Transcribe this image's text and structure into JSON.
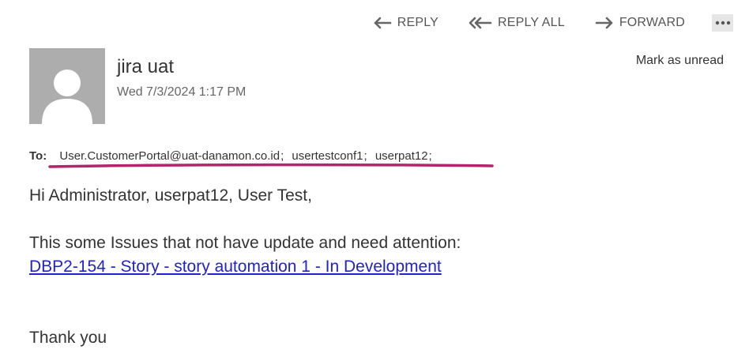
{
  "toolbar": {
    "reply": "REPLY",
    "reply_all": "REPLY ALL",
    "forward": "FORWARD",
    "more_icon": "more-horizontal-icon"
  },
  "header": {
    "sender": "jira uat",
    "date": "Wed 7/3/2024 1:17 PM",
    "mark_unread": "Mark as unread",
    "avatar_icon": "person-icon"
  },
  "recipients": {
    "label": "To:",
    "list": [
      "User.CustomerPortal@uat-danamon.co.id",
      "usertestconf1",
      "userpat12"
    ],
    "separator": ";"
  },
  "body": {
    "greeting": "Hi Administrator, userpat12, User Test,",
    "intro": "This some Issues that not have update and need attention:",
    "issue_link": "DBP2-154 - Story - story automation 1 - In Development",
    "closing": "Thank you"
  },
  "colors": {
    "link": "#2222cc",
    "highlight_mark": "#b3246b",
    "avatar_bg": "#adadad"
  }
}
